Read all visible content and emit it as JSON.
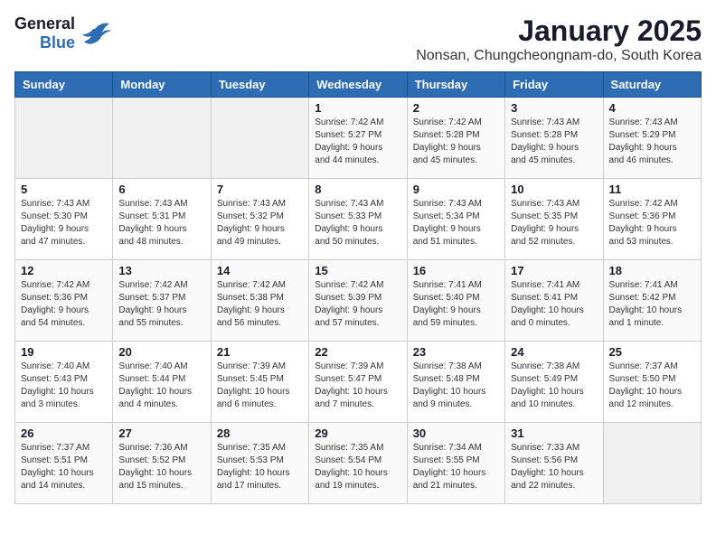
{
  "header": {
    "logo_line1": "General",
    "logo_line2": "Blue",
    "title": "January 2025",
    "subtitle": "Nonsan, Chungcheongnam-do, South Korea"
  },
  "weekdays": [
    "Sunday",
    "Monday",
    "Tuesday",
    "Wednesday",
    "Thursday",
    "Friday",
    "Saturday"
  ],
  "weeks": [
    [
      {
        "day": "",
        "info": ""
      },
      {
        "day": "",
        "info": ""
      },
      {
        "day": "",
        "info": ""
      },
      {
        "day": "1",
        "info": "Sunrise: 7:42 AM\nSunset: 5:27 PM\nDaylight: 9 hours\nand 44 minutes."
      },
      {
        "day": "2",
        "info": "Sunrise: 7:42 AM\nSunset: 5:28 PM\nDaylight: 9 hours\nand 45 minutes."
      },
      {
        "day": "3",
        "info": "Sunrise: 7:43 AM\nSunset: 5:28 PM\nDaylight: 9 hours\nand 45 minutes."
      },
      {
        "day": "4",
        "info": "Sunrise: 7:43 AM\nSunset: 5:29 PM\nDaylight: 9 hours\nand 46 minutes."
      }
    ],
    [
      {
        "day": "5",
        "info": "Sunrise: 7:43 AM\nSunset: 5:30 PM\nDaylight: 9 hours\nand 47 minutes."
      },
      {
        "day": "6",
        "info": "Sunrise: 7:43 AM\nSunset: 5:31 PM\nDaylight: 9 hours\nand 48 minutes."
      },
      {
        "day": "7",
        "info": "Sunrise: 7:43 AM\nSunset: 5:32 PM\nDaylight: 9 hours\nand 49 minutes."
      },
      {
        "day": "8",
        "info": "Sunrise: 7:43 AM\nSunset: 5:33 PM\nDaylight: 9 hours\nand 50 minutes."
      },
      {
        "day": "9",
        "info": "Sunrise: 7:43 AM\nSunset: 5:34 PM\nDaylight: 9 hours\nand 51 minutes."
      },
      {
        "day": "10",
        "info": "Sunrise: 7:43 AM\nSunset: 5:35 PM\nDaylight: 9 hours\nand 52 minutes."
      },
      {
        "day": "11",
        "info": "Sunrise: 7:42 AM\nSunset: 5:36 PM\nDaylight: 9 hours\nand 53 minutes."
      }
    ],
    [
      {
        "day": "12",
        "info": "Sunrise: 7:42 AM\nSunset: 5:36 PM\nDaylight: 9 hours\nand 54 minutes."
      },
      {
        "day": "13",
        "info": "Sunrise: 7:42 AM\nSunset: 5:37 PM\nDaylight: 9 hours\nand 55 minutes."
      },
      {
        "day": "14",
        "info": "Sunrise: 7:42 AM\nSunset: 5:38 PM\nDaylight: 9 hours\nand 56 minutes."
      },
      {
        "day": "15",
        "info": "Sunrise: 7:42 AM\nSunset: 5:39 PM\nDaylight: 9 hours\nand 57 minutes."
      },
      {
        "day": "16",
        "info": "Sunrise: 7:41 AM\nSunset: 5:40 PM\nDaylight: 9 hours\nand 59 minutes."
      },
      {
        "day": "17",
        "info": "Sunrise: 7:41 AM\nSunset: 5:41 PM\nDaylight: 10 hours\nand 0 minutes."
      },
      {
        "day": "18",
        "info": "Sunrise: 7:41 AM\nSunset: 5:42 PM\nDaylight: 10 hours\nand 1 minute."
      }
    ],
    [
      {
        "day": "19",
        "info": "Sunrise: 7:40 AM\nSunset: 5:43 PM\nDaylight: 10 hours\nand 3 minutes."
      },
      {
        "day": "20",
        "info": "Sunrise: 7:40 AM\nSunset: 5:44 PM\nDaylight: 10 hours\nand 4 minutes."
      },
      {
        "day": "21",
        "info": "Sunrise: 7:39 AM\nSunset: 5:45 PM\nDaylight: 10 hours\nand 6 minutes."
      },
      {
        "day": "22",
        "info": "Sunrise: 7:39 AM\nSunset: 5:47 PM\nDaylight: 10 hours\nand 7 minutes."
      },
      {
        "day": "23",
        "info": "Sunrise: 7:38 AM\nSunset: 5:48 PM\nDaylight: 10 hours\nand 9 minutes."
      },
      {
        "day": "24",
        "info": "Sunrise: 7:38 AM\nSunset: 5:49 PM\nDaylight: 10 hours\nand 10 minutes."
      },
      {
        "day": "25",
        "info": "Sunrise: 7:37 AM\nSunset: 5:50 PM\nDaylight: 10 hours\nand 12 minutes."
      }
    ],
    [
      {
        "day": "26",
        "info": "Sunrise: 7:37 AM\nSunset: 5:51 PM\nDaylight: 10 hours\nand 14 minutes."
      },
      {
        "day": "27",
        "info": "Sunrise: 7:36 AM\nSunset: 5:52 PM\nDaylight: 10 hours\nand 15 minutes."
      },
      {
        "day": "28",
        "info": "Sunrise: 7:35 AM\nSunset: 5:53 PM\nDaylight: 10 hours\nand 17 minutes."
      },
      {
        "day": "29",
        "info": "Sunrise: 7:35 AM\nSunset: 5:54 PM\nDaylight: 10 hours\nand 19 minutes."
      },
      {
        "day": "30",
        "info": "Sunrise: 7:34 AM\nSunset: 5:55 PM\nDaylight: 10 hours\nand 21 minutes."
      },
      {
        "day": "31",
        "info": "Sunrise: 7:33 AM\nSunset: 5:56 PM\nDaylight: 10 hours\nand 22 minutes."
      },
      {
        "day": "",
        "info": ""
      }
    ]
  ]
}
